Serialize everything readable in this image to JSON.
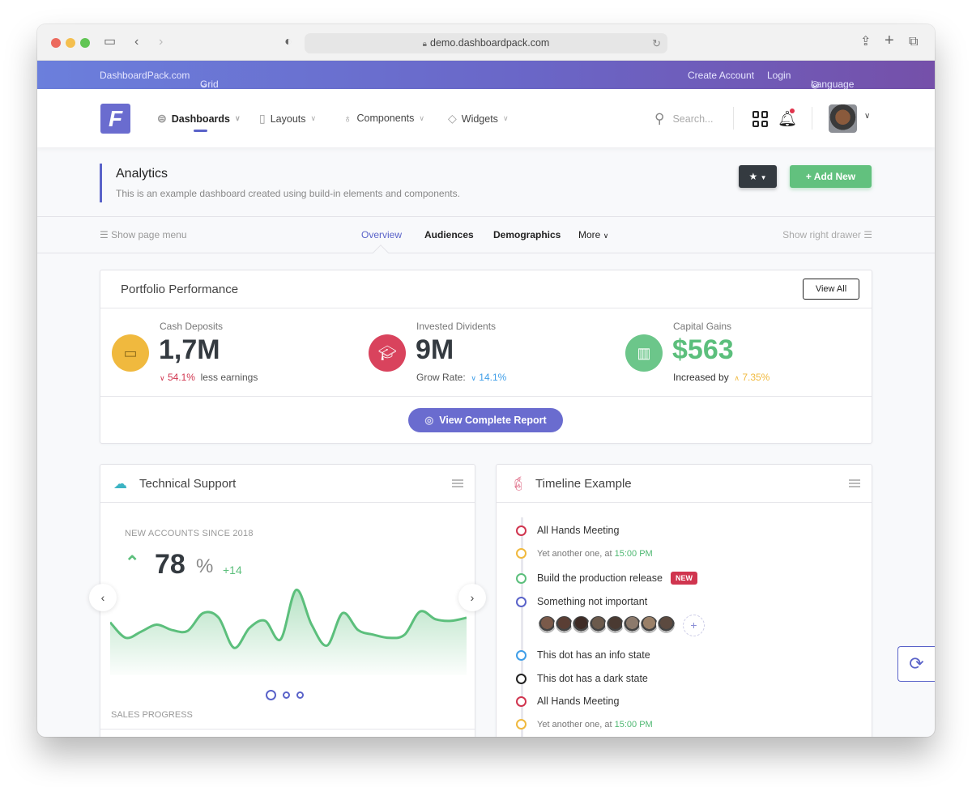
{
  "browser": {
    "url": "demo.dashboardpack.com",
    "icons": [
      "sidebar-icon",
      "back-icon",
      "forward-icon",
      "shield-icon",
      "lock-icon",
      "reload-icon",
      "share-icon",
      "new-tab-icon",
      "tabs-icon"
    ]
  },
  "topbar": {
    "brand_link": "DashboardPack.com",
    "grid_menu": "Grid Menu",
    "create_account": "Create Account",
    "login": "Login",
    "language": "Language"
  },
  "header": {
    "logo_letter": "F",
    "nav": [
      {
        "label": "Dashboards",
        "icon": "signpost-icon",
        "active": true
      },
      {
        "label": "Layouts",
        "icon": "file-icon"
      },
      {
        "label": "Components",
        "icon": "bulb-icon"
      },
      {
        "label": "Widgets",
        "icon": "tag-icon"
      }
    ],
    "search_placeholder": "Search...",
    "colors": {
      "accent": "#5a63c9",
      "notification": "#e0344c"
    }
  },
  "page": {
    "title": "Analytics",
    "subtitle": "This is an example dashboard created using build-in elements and components.",
    "add_new": "Add New"
  },
  "tabs": {
    "show_page_menu": "Show page menu",
    "items": [
      "Overview",
      "Audiences",
      "Demographics",
      "More"
    ],
    "active": "Overview",
    "show_right_drawer": "Show right drawer"
  },
  "portfolio": {
    "title": "Portfolio Performance",
    "view_all": "View All",
    "metrics": [
      {
        "label": "Cash Deposits",
        "value": "1,7M",
        "change": "54.1%",
        "direction": "down",
        "suffix": "less earnings",
        "icon": "devices-icon",
        "color": "#f0b93e"
      },
      {
        "label": "Invested Dividents",
        "value": "9M",
        "prefix": "Grow Rate:",
        "change": "14.1%",
        "direction": "down",
        "icon": "graduation-cap-icon",
        "color": "#d9435d"
      },
      {
        "label": "Capital Gains",
        "value": "$563",
        "prefix": "Increased by",
        "change": "7.35%",
        "direction": "up",
        "icon": "building-icon",
        "color": "#6cc68a"
      }
    ],
    "report_button": "View Complete Report"
  },
  "tech_support": {
    "title": "Technical Support",
    "new_accounts_label": "NEW ACCOUNTS SINCE 2018",
    "value": "78",
    "unit": "%",
    "delta": "+14",
    "sales_progress_label": "SALES PROGRESS",
    "carousel_pages": 3,
    "carousel_active": 1
  },
  "chart_data": {
    "type": "area",
    "title": "New Accounts Since 2018",
    "xlabel": "",
    "ylabel": "",
    "values": [
      58,
      38,
      46,
      55,
      48,
      47,
      70,
      64,
      25,
      51,
      60,
      36,
      100,
      55,
      28,
      70,
      48,
      42,
      38,
      42,
      72,
      62,
      60,
      64
    ],
    "ylim": [
      0,
      110
    ],
    "grid": false,
    "color": "#5cbf7c"
  },
  "timeline": {
    "title": "Timeline Example",
    "items": [
      {
        "text": "All Hands Meeting",
        "color": "#d0354f"
      },
      {
        "text": "Yet another one, at ",
        "time": "15:00 PM",
        "color": "#f0b93e",
        "small": true
      },
      {
        "text": "Build the production release",
        "badge": "NEW",
        "color": "#5cbf7c"
      },
      {
        "text": "Something not important",
        "color": "#5a63c9"
      },
      {
        "text": "This dot has an info state",
        "color": "#3f9ee8"
      },
      {
        "text": "This dot has a dark state",
        "color": "#222222"
      },
      {
        "text": "All Hands Meeting",
        "color": "#d0354f"
      },
      {
        "text": "Yet another one, at ",
        "time": "15:00 PM",
        "color": "#f0b93e",
        "small": true
      }
    ],
    "avatar_count": 8,
    "add_avatar": "+"
  }
}
